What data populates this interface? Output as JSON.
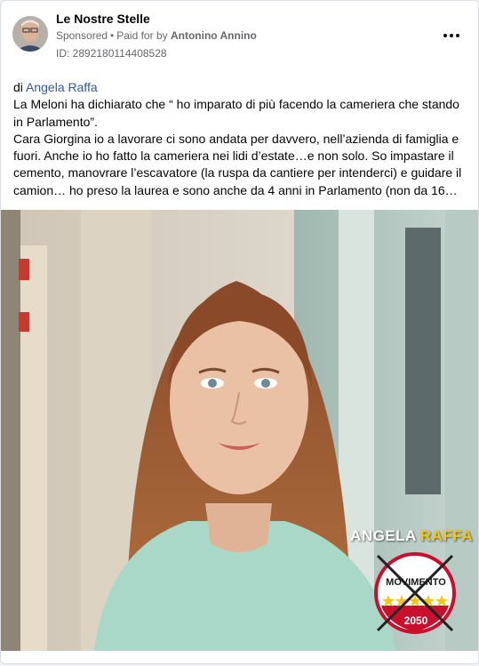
{
  "post": {
    "page_name": "Le Nostre Stelle",
    "sponsored_label": "Sponsored",
    "separator": "•",
    "paid_for_prefix": "Paid for by",
    "payer": "Antonino Annino",
    "ad_id": "ID: 2892180114408528",
    "more_icon": "more-dots-icon"
  },
  "body": {
    "author_prefix": "di ",
    "author": "Angela Raffa",
    "paragraph_1": "La Meloni ha dichiarato che “ ho imparato di più facendo la cameriera che stando in Parlamento”.",
    "paragraph_2": "Cara Giorgina io a lavorare ci sono andata per davvero, nell’azienda di famiglia e fuori. Anche io ho fatto la cameriera nei lidi d’estate…e non solo. So impastare il cemento, manovrare l’escavatore (la ruspa da cantiere per intenderci) e guidare il camion… ho preso la laurea e sono anche da 4 anni in Parlamento (non da 16…"
  },
  "media": {
    "overlay_first": "ANGELA",
    "overlay_last": "RAFFA",
    "logo_word": "MOVIMENTO",
    "logo_year": "2050"
  },
  "colors": {
    "link": "#385898",
    "secondary_text": "#65676b",
    "overlay_accent": "#f5c518",
    "logo_red": "#c8102e",
    "logo_star": "#f5c518"
  }
}
